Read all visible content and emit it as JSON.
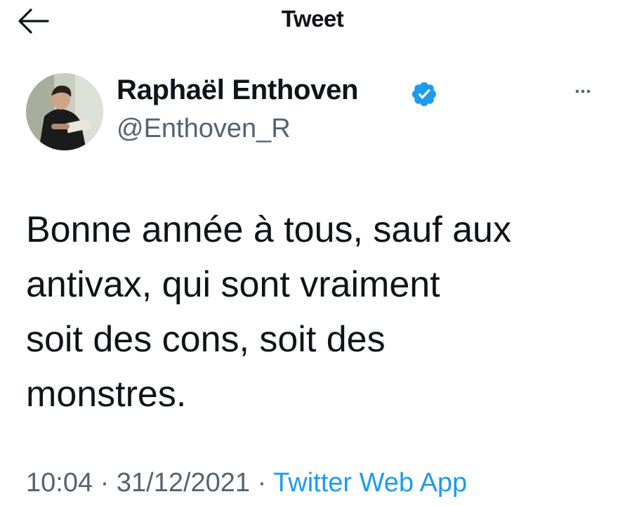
{
  "header": {
    "title": "Tweet",
    "back_icon": "arrow-left-icon"
  },
  "author": {
    "name": "Raphaël Enthoven",
    "handle": "@Enthoven_R",
    "verified_icon": "verified-badge-icon",
    "more_icon": "more-options-icon"
  },
  "tweet": {
    "lines": [
      "Bonne année à tous, sauf aux",
      "antivax, qui sont vraiment",
      "soit des cons, soit des",
      "monstres."
    ],
    "time": "10:04",
    "separator": "·",
    "date": "31/12/2021",
    "source": "Twitter Web App"
  },
  "colors": {
    "text": "#0f1419",
    "secondary": "#536471",
    "accent": "#1d9bf0"
  }
}
